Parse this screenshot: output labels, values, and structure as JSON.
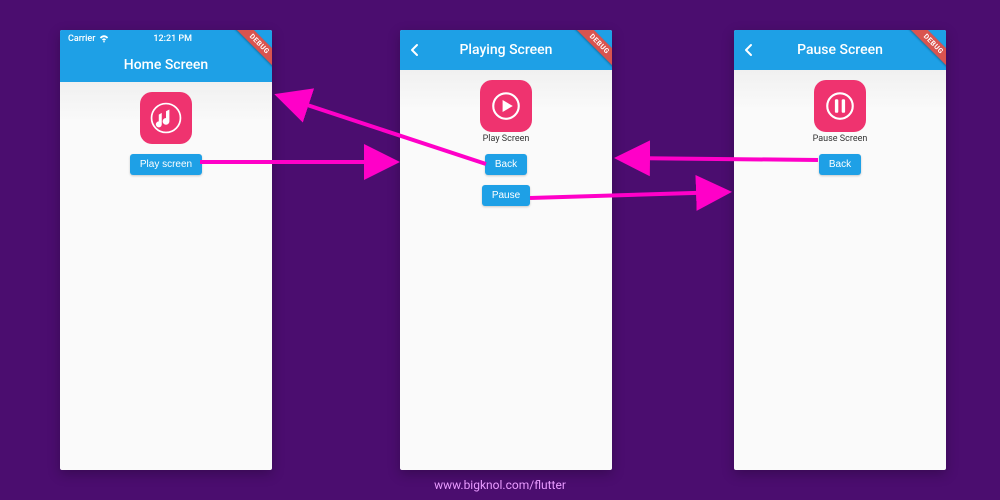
{
  "phones": {
    "home": {
      "status": {
        "carrier": "Carrier",
        "time": "12:21 PM"
      },
      "title": "Home Screen",
      "has_back": false,
      "icon": "music-note-icon",
      "icon_caption": "",
      "buttons": [
        {
          "name": "play-screen-button",
          "label": "Play screen"
        }
      ],
      "debug_ribbon": "DEBUG"
    },
    "play": {
      "status": null,
      "title": "Playing Screen",
      "has_back": true,
      "icon": "play-icon",
      "icon_caption": "Play Screen",
      "buttons": [
        {
          "name": "back-button",
          "label": "Back"
        },
        {
          "name": "pause-button",
          "label": "Pause"
        }
      ],
      "debug_ribbon": "DEBUG"
    },
    "pause": {
      "status": null,
      "title": "Pause Screen",
      "has_back": true,
      "icon": "pause-icon",
      "icon_caption": "Pause Screen",
      "buttons": [
        {
          "name": "back-button",
          "label": "Back"
        }
      ],
      "debug_ribbon": "DEBUG"
    }
  },
  "arrow_color": "#ff00c8",
  "footer": "www.bigknol.com/flutter"
}
